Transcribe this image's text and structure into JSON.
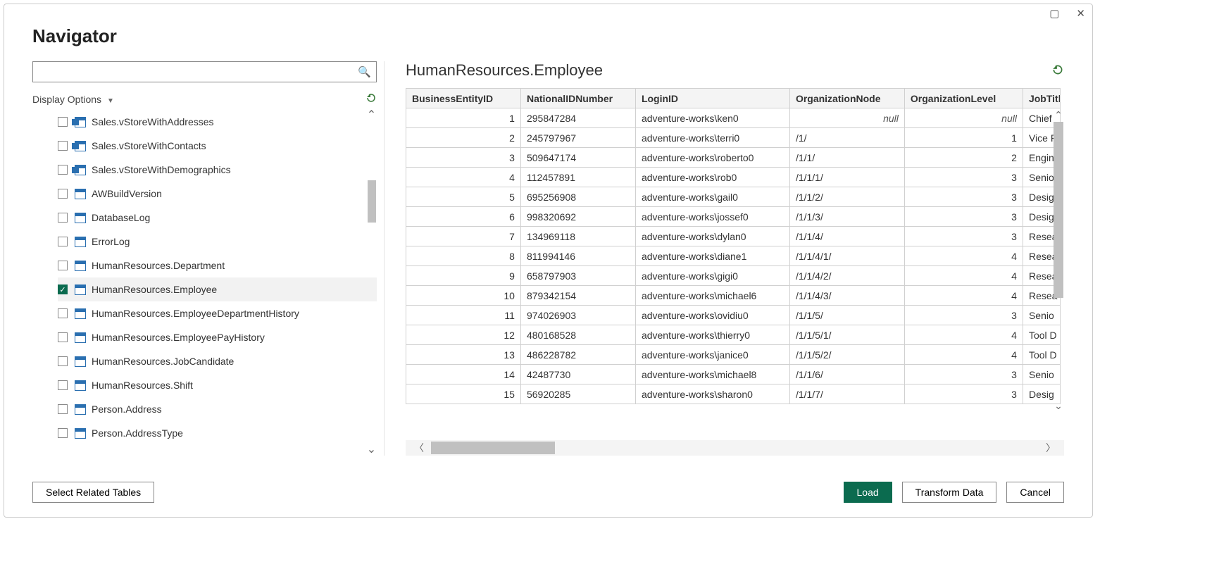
{
  "dialog": {
    "title": "Navigator",
    "display_options_label": "Display Options",
    "select_related_label": "Select Related Tables",
    "load_label": "Load",
    "transform_label": "Transform Data",
    "cancel_label": "Cancel"
  },
  "search": {
    "value": "",
    "placeholder": ""
  },
  "tree": [
    {
      "label": "Sales.vStoreWithAddresses",
      "icon": "view",
      "checked": false
    },
    {
      "label": "Sales.vStoreWithContacts",
      "icon": "view",
      "checked": false
    },
    {
      "label": "Sales.vStoreWithDemographics",
      "icon": "view",
      "checked": false
    },
    {
      "label": "AWBuildVersion",
      "icon": "table",
      "checked": false
    },
    {
      "label": "DatabaseLog",
      "icon": "table",
      "checked": false
    },
    {
      "label": "ErrorLog",
      "icon": "table",
      "checked": false
    },
    {
      "label": "HumanResources.Department",
      "icon": "table",
      "checked": false
    },
    {
      "label": "HumanResources.Employee",
      "icon": "table",
      "checked": true
    },
    {
      "label": "HumanResources.EmployeeDepartmentHistory",
      "icon": "table",
      "checked": false
    },
    {
      "label": "HumanResources.EmployeePayHistory",
      "icon": "table",
      "checked": false
    },
    {
      "label": "HumanResources.JobCandidate",
      "icon": "table",
      "checked": false
    },
    {
      "label": "HumanResources.Shift",
      "icon": "table",
      "checked": false
    },
    {
      "label": "Person.Address",
      "icon": "table",
      "checked": false
    },
    {
      "label": "Person.AddressType",
      "icon": "table",
      "checked": false
    }
  ],
  "preview": {
    "title": "HumanResources.Employee",
    "columns": [
      "BusinessEntityID",
      "NationalIDNumber",
      "LoginID",
      "OrganizationNode",
      "OrganizationLevel",
      "JobTitle"
    ],
    "rows": [
      {
        "id": "1",
        "nid": "295847284",
        "login": "adventure-works\\ken0",
        "org": null,
        "lvl": null,
        "job": "Chief"
      },
      {
        "id": "2",
        "nid": "245797967",
        "login": "adventure-works\\terri0",
        "org": "/1/",
        "lvl": "1",
        "job": "Vice P"
      },
      {
        "id": "3",
        "nid": "509647174",
        "login": "adventure-works\\roberto0",
        "org": "/1/1/",
        "lvl": "2",
        "job": "Engin"
      },
      {
        "id": "4",
        "nid": "112457891",
        "login": "adventure-works\\rob0",
        "org": "/1/1/1/",
        "lvl": "3",
        "job": "Senio"
      },
      {
        "id": "5",
        "nid": "695256908",
        "login": "adventure-works\\gail0",
        "org": "/1/1/2/",
        "lvl": "3",
        "job": "Desig"
      },
      {
        "id": "6",
        "nid": "998320692",
        "login": "adventure-works\\jossef0",
        "org": "/1/1/3/",
        "lvl": "3",
        "job": "Desig"
      },
      {
        "id": "7",
        "nid": "134969118",
        "login": "adventure-works\\dylan0",
        "org": "/1/1/4/",
        "lvl": "3",
        "job": "Resea"
      },
      {
        "id": "8",
        "nid": "811994146",
        "login": "adventure-works\\diane1",
        "org": "/1/1/4/1/",
        "lvl": "4",
        "job": "Resea"
      },
      {
        "id": "9",
        "nid": "658797903",
        "login": "adventure-works\\gigi0",
        "org": "/1/1/4/2/",
        "lvl": "4",
        "job": "Resea"
      },
      {
        "id": "10",
        "nid": "879342154",
        "login": "adventure-works\\michael6",
        "org": "/1/1/4/3/",
        "lvl": "4",
        "job": "Resea"
      },
      {
        "id": "11",
        "nid": "974026903",
        "login": "adventure-works\\ovidiu0",
        "org": "/1/1/5/",
        "lvl": "3",
        "job": "Senio"
      },
      {
        "id": "12",
        "nid": "480168528",
        "login": "adventure-works\\thierry0",
        "org": "/1/1/5/1/",
        "lvl": "4",
        "job": "Tool D"
      },
      {
        "id": "13",
        "nid": "486228782",
        "login": "adventure-works\\janice0",
        "org": "/1/1/5/2/",
        "lvl": "4",
        "job": "Tool D"
      },
      {
        "id": "14",
        "nid": "42487730",
        "login": "adventure-works\\michael8",
        "org": "/1/1/6/",
        "lvl": "3",
        "job": "Senio"
      },
      {
        "id": "15",
        "nid": "56920285",
        "login": "adventure-works\\sharon0",
        "org": "/1/1/7/",
        "lvl": "3",
        "job": "Desig"
      }
    ]
  }
}
